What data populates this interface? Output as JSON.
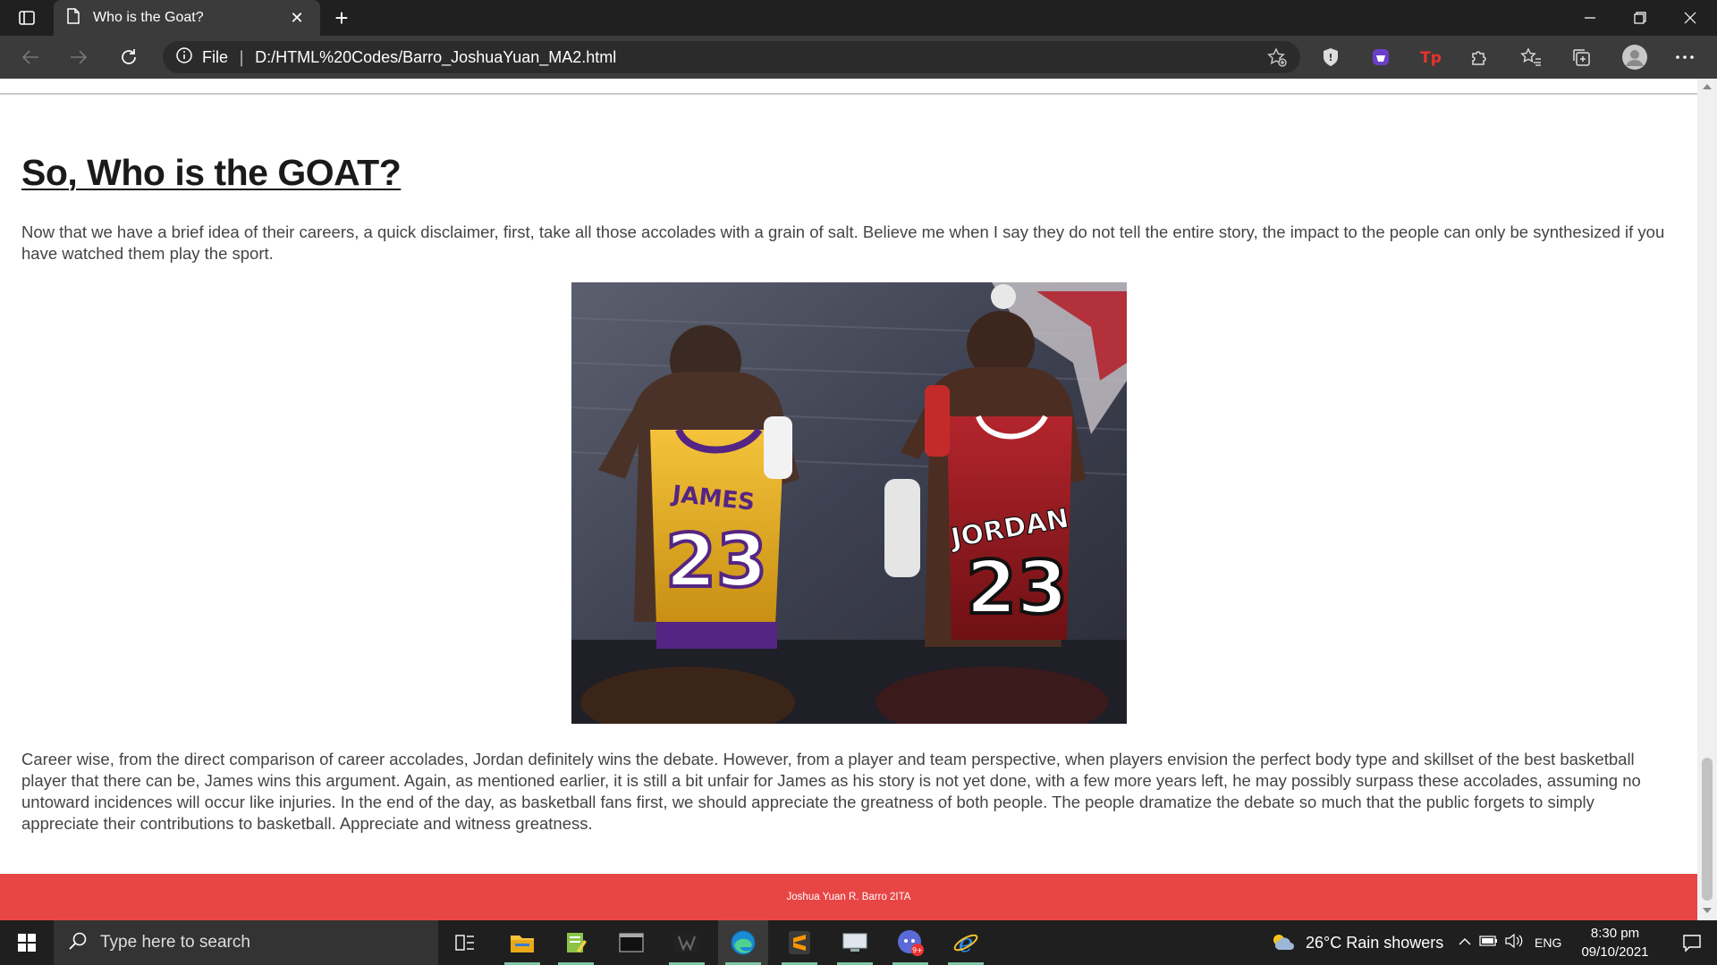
{
  "browser": {
    "tab_title": "Who is the Goat?",
    "address_scheme_label": "File",
    "address_url": "D:/HTML%20Codes/Barro_JoshuaYuan_MA2.html"
  },
  "page": {
    "heading": "So, Who is the GOAT?",
    "paragraph_1": "Now that we have a brief idea of their careers, a quick disclaimer, first, take all those accolades with a grain of salt. Believe me when I say they do not tell the entire story, the impact to the people can only be synthesized if you have watched them play the sport.",
    "image": {
      "left_jersey_name": "JAMES",
      "left_jersey_number": "23",
      "right_jersey_name": "JORDAN",
      "right_jersey_number": "23"
    },
    "paragraph_2": "Career wise, from the direct comparison of career accolades, Jordan definitely wins the debate. However, from a player and team perspective, when players envision the perfect body type and skillset of the best basketball player that there can be, James wins this argument. Again, as mentioned earlier, it is still a bit unfair for James as his story is not yet done, with a few more years left, he may possibly surpass these accolades, assuming no untoward incidences will occur like injuries. In the end of the day, as basketball fans first, we should appreciate the greatness of both people. The people dramatize the debate so much that the public forgets to simply appreciate their contributions to basketball. Appreciate and witness greatness.",
    "footer": "Joshua Yuan R. Barro 2ITA"
  },
  "taskbar": {
    "search_placeholder": "Type here to search",
    "weather": "26°C  Rain showers",
    "language": "ENG",
    "time": "8:30 pm",
    "date": "09/10/2021"
  },
  "colors": {
    "footer_bg": "#e84545",
    "chrome_dark": "#202020",
    "toolbar": "#3b3b3b"
  }
}
